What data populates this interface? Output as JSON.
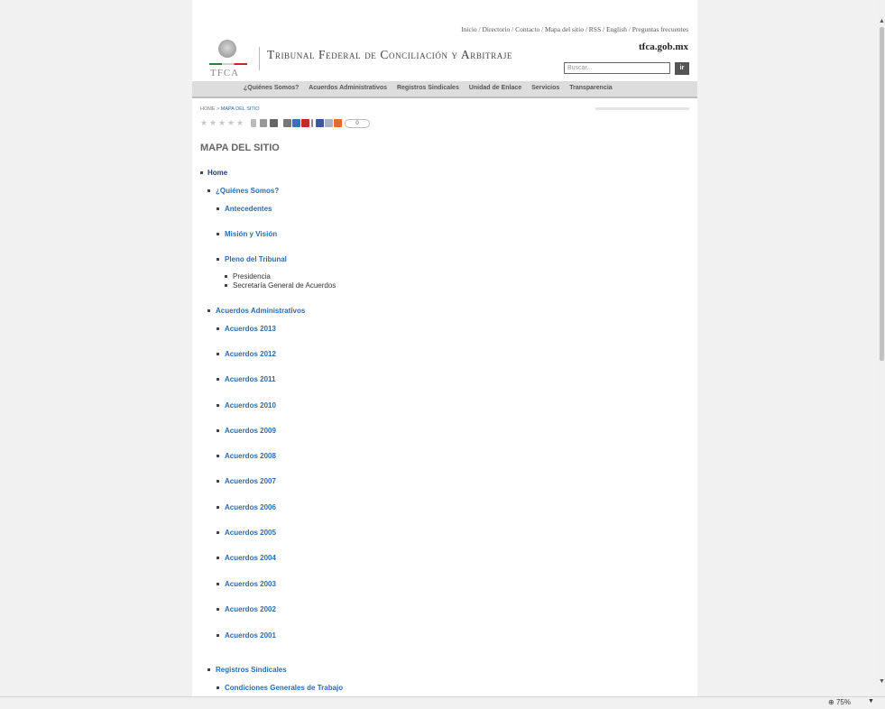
{
  "top_links": "Inicio / Directorio / Contacto / Mapa del sitio / RSS / English / Preguntas frecuentes",
  "header": {
    "logo_text": "TFCA",
    "title": "Tribunal Federal de Conciliación y Arbitraje",
    "domain": "tfca.gob.mx",
    "search_placeholder": "Buscar...",
    "search_button": "ir"
  },
  "nav": [
    "¿Quiénes Somos?",
    "Acuerdos Administrativos",
    "Registros Sindicales",
    "Unidad de Enlace",
    "Servicios",
    "Transparencia"
  ],
  "breadcrumb": {
    "home": "HOME",
    "sep": " > ",
    "current": "MAPA DEL SITIO"
  },
  "toolbar": {
    "counter": "0"
  },
  "page_title": "MAPA DEL SITIO",
  "sitemap": {
    "home": "Home",
    "quienes": "¿Quiénes Somos?",
    "antecedentes": "Antecedentes",
    "mision": "Misión y Visión",
    "pleno": "Pleno del Tribunal",
    "presidencia": "Presidencia",
    "secretaria": "Secretaría General de Acuerdos",
    "acuerdos": "Acuerdos Administrativos",
    "acuerdos_years": [
      "Acuerdos 2013",
      "Acuerdos 2012",
      "Acuerdos 2011",
      "Acuerdos 2010",
      "Acuerdos 2009",
      "Acuerdos 2008",
      "Acuerdos 2007",
      "Acuerdos 2006",
      "Acuerdos 2005",
      "Acuerdos 2004",
      "Acuerdos 2003",
      "Acuerdos 2002",
      "Acuerdos 2001"
    ],
    "registros": "Registros Sindicales",
    "condiciones": "Condiciones Generales de Trabajo"
  },
  "status_bar": {
    "zoom": "75%"
  },
  "colors": {
    "link": "#2a6cb0",
    "home_link": "#1d3f78",
    "nav_bg": "#dddddd"
  }
}
